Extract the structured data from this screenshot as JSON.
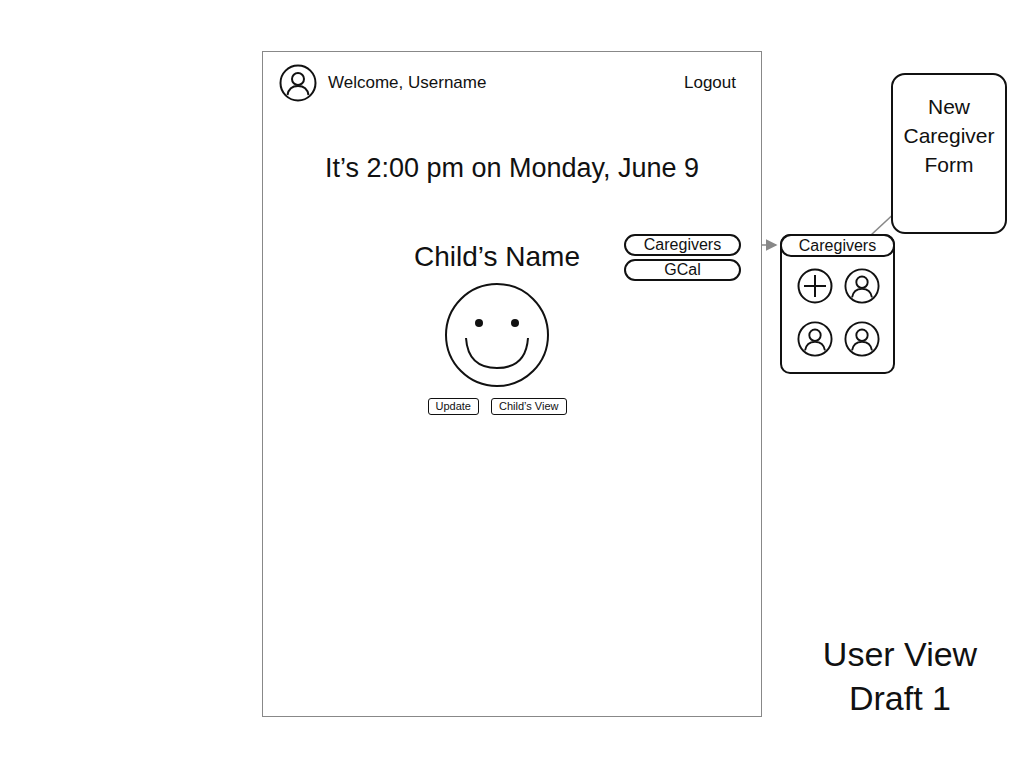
{
  "screen": {
    "welcome": "Welcome, Username",
    "logout": "Logout",
    "datetime": "It’s 2:00 pm on Monday, June 9",
    "child_name": "Child’s Name",
    "buttons": [
      "Update",
      "Child’s View"
    ],
    "menu": [
      "Caregivers",
      "GCal"
    ]
  },
  "caregivers_panel": {
    "title": "Caregivers",
    "items": [
      {
        "kind": "add"
      },
      {
        "kind": "caregiver"
      },
      {
        "kind": "caregiver"
      },
      {
        "kind": "caregiver"
      }
    ]
  },
  "form": {
    "title": "New Caregiver Form"
  },
  "label": "User View Draft 1"
}
